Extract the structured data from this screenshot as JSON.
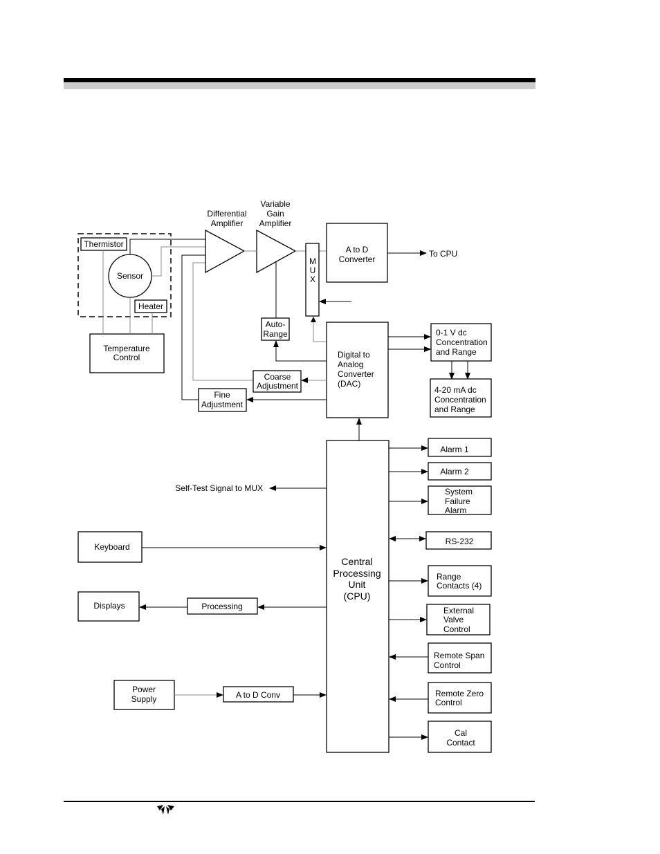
{
  "colors": {
    "rule_dark": "#000000",
    "rule_light": "#cccccc",
    "line": "#000000"
  },
  "blocks": {
    "thermistor": "Thermistor",
    "sensor": "Sensor",
    "heater": "Heater",
    "temperature_control": [
      "Temperature",
      "Control"
    ],
    "differential_amplifier": [
      "Differential",
      "Amplifier"
    ],
    "variable_gain_amplifier": [
      "Variable",
      "Gain",
      "Amplifier"
    ],
    "mux": [
      "M",
      "U",
      "X"
    ],
    "a_to_d_converter": [
      "A to D",
      "Converter"
    ],
    "to_cpu": "To CPU",
    "auto_range": [
      "Auto-",
      "Range"
    ],
    "dac": [
      "Digital to",
      "Analog",
      "Converter",
      "(DAC)"
    ],
    "coarse_adjustment": [
      "Coarse",
      "Adjustment"
    ],
    "fine_adjustment": [
      "Fine",
      "Adjustment"
    ],
    "output_voltage": [
      "0-1 V dc",
      "Concentration",
      "and Range"
    ],
    "output_current": [
      "4-20 mA dc",
      "Concentration",
      "and Range"
    ],
    "cpu": [
      "Central",
      "Processing",
      "Unit",
      "(CPU)"
    ],
    "self_test": "Self-Test Signal to MUX",
    "keyboard": "Keyboard",
    "displays": "Displays",
    "processing": "Processing",
    "power_supply": [
      "Power",
      "Supply"
    ],
    "a_to_d_conv": "A to D Conv",
    "alarm1": "Alarm 1",
    "alarm2": "Alarm 2",
    "system_failure_alarm": [
      "System",
      "Failure",
      "Alarm"
    ],
    "rs232": "RS-232",
    "range_contacts": [
      "Range",
      "Contacts (4)"
    ],
    "external_valve_control": [
      "External",
      "Valve",
      "Control"
    ],
    "remote_span_control": [
      "Remote Span",
      "Control"
    ],
    "remote_zero_control": [
      "Remote Zero",
      "Control"
    ],
    "cal_contact": [
      "Cal",
      "Contact"
    ]
  },
  "footer": {
    "logo": "teledyne-logo"
  }
}
